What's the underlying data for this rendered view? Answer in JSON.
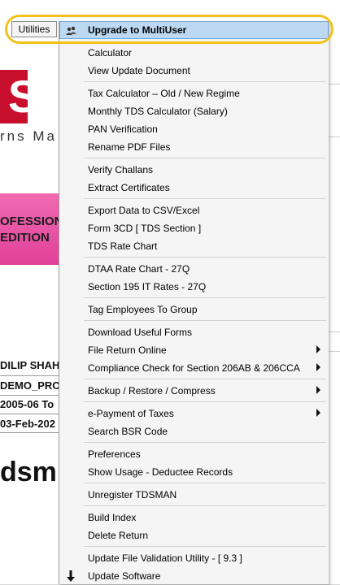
{
  "menubar": {
    "utilities_label": "Utilities"
  },
  "background": {
    "logo_letters": "SM",
    "tagline": "rns Ma",
    "edition_line1": "OFESSION",
    "edition_line2": "EDITION",
    "info_lines": [
      "DILIP SHAH",
      "DEMO_PRO",
      "2005-06 To",
      "03-Feb-202"
    ],
    "brand_text": "dsm"
  },
  "menu": {
    "items": [
      {
        "label": "Upgrade to MultiUser",
        "icon": "users-icon",
        "highlighted": true
      },
      {
        "label": "Calculator"
      },
      {
        "label": "View Update Document"
      },
      {
        "label": "Tax Calculator – Old / New Regime"
      },
      {
        "label": "Monthly TDS Calculator (Salary)"
      },
      {
        "label": "PAN Verification"
      },
      {
        "label": "Rename PDF Files"
      },
      {
        "label": "Verify Challans"
      },
      {
        "label": "Extract Certificates"
      },
      {
        "label": "Export Data to CSV/Excel"
      },
      {
        "label": "Form 3CD [ TDS Section ]"
      },
      {
        "label": "TDS Rate Chart"
      },
      {
        "label": "DTAA Rate Chart - 27Q"
      },
      {
        "label": "Section 195 IT Rates - 27Q"
      },
      {
        "label": "Tag Employees To Group"
      },
      {
        "label": "Download Useful Forms"
      },
      {
        "label": "File Return Online",
        "submenu": true
      },
      {
        "label": "Compliance Check for Section 206AB & 206CCA",
        "submenu": true
      },
      {
        "label": "Backup / Restore / Compress",
        "submenu": true
      },
      {
        "label": "e-Payment of Taxes",
        "submenu": true
      },
      {
        "label": "Search BSR Code"
      },
      {
        "label": "Preferences"
      },
      {
        "label": "Show Usage - Deductee Records"
      },
      {
        "label": "Unregister TDSMAN"
      },
      {
        "label": "Build Index"
      },
      {
        "label": "Delete Return"
      },
      {
        "label": "Update File Validation Utility - [ 9.3 ]"
      },
      {
        "label": "Update Software",
        "icon": "download-arrow-icon"
      }
    ]
  },
  "colors": {
    "highlight_ring": "#f2c21b",
    "menu_highlight": "#bcd8f2",
    "edition_pink": "#e0419a",
    "logo_red": "#c8102e"
  }
}
